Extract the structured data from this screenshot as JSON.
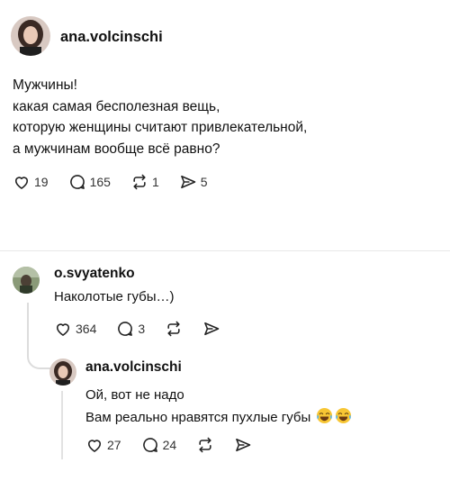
{
  "post": {
    "username": "ana.volcinschi",
    "lines": [
      "Мужчины!",
      "какая самая бесполезная вещь,",
      "которую женщины считают привлекательной,",
      "а мужчинам вообще всё равно?"
    ],
    "likes": "19",
    "comments": "165",
    "reposts": "1",
    "shares": "5"
  },
  "reply1": {
    "username": "o.svyatenko",
    "text": "Наколотые губы…)",
    "likes": "364",
    "comments": "3"
  },
  "reply2": {
    "username": "ana.volcinschi",
    "line1": "Ой, вот не надо",
    "line2": "Вам реально нравятся пухлые губы",
    "likes": "27",
    "comments": "24"
  },
  "icons": {
    "like": "heart-icon",
    "comment": "comment-bubble-icon",
    "repost": "repost-icon",
    "share": "send-icon",
    "emoji": "laughing-tears-emoji"
  }
}
